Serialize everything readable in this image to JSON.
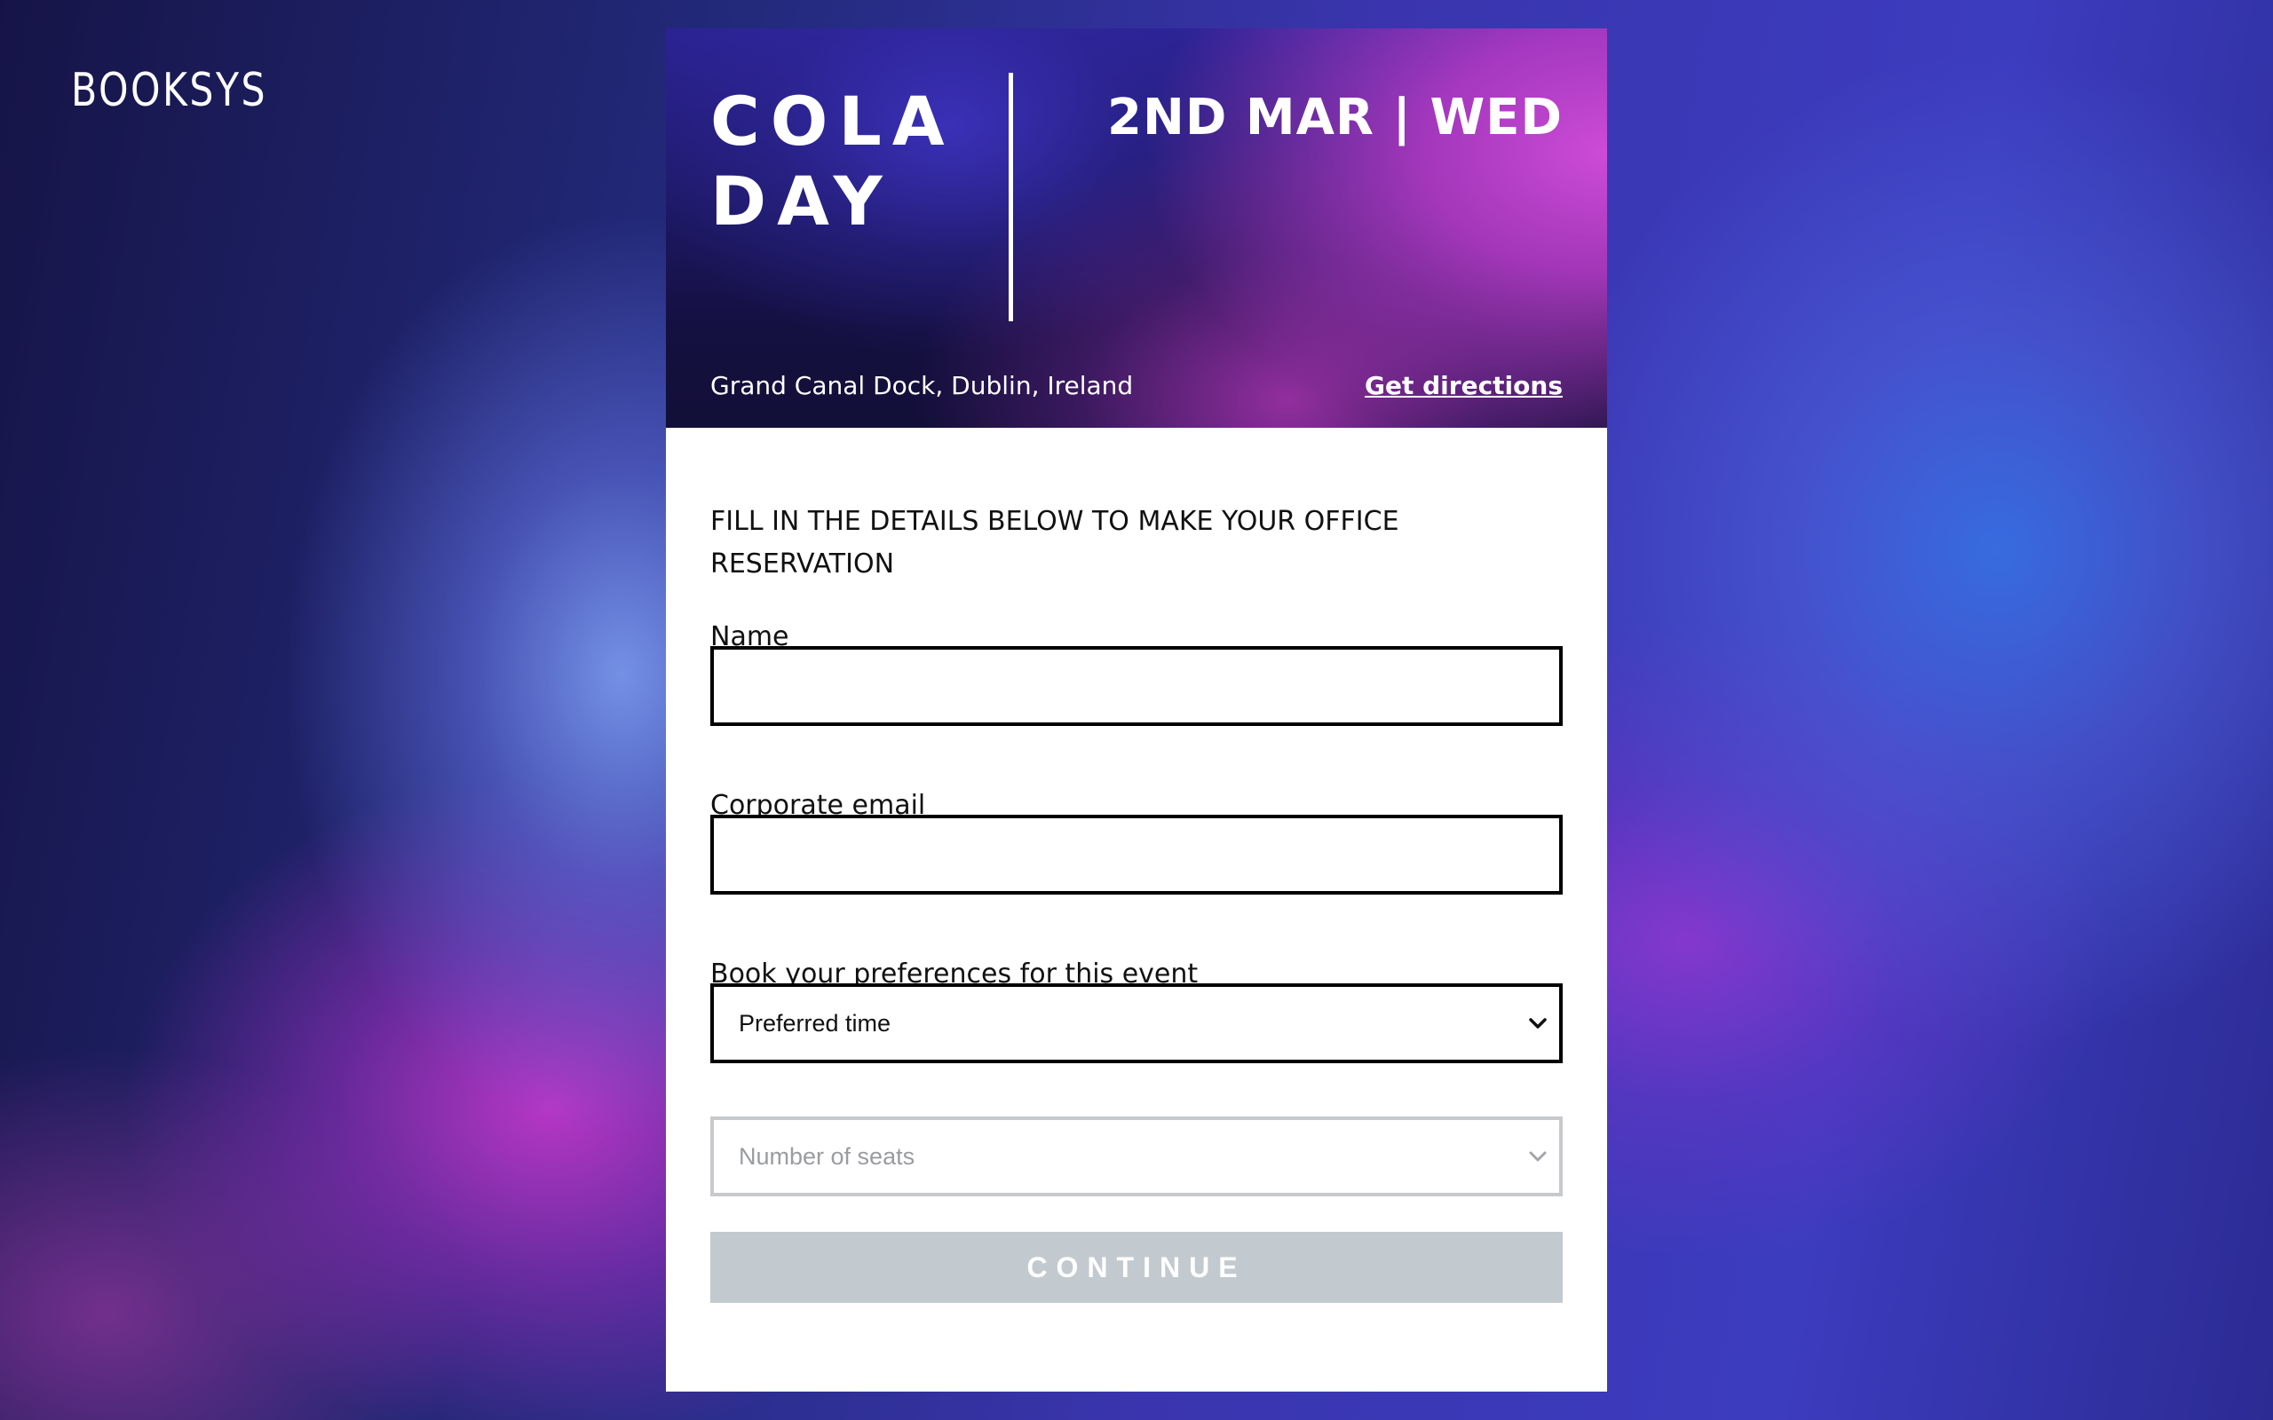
{
  "brand": {
    "logo_text": "BOOKSYS"
  },
  "event": {
    "title": "COLA DAY",
    "date": "2ND MAR | WED",
    "location": "Grand Canal Dock, Dublin, Ireland",
    "directions_label": "Get directions"
  },
  "form": {
    "intro": "FILL IN THE DETAILS BELOW TO MAKE YOUR OFFICE RESERVATION",
    "name_label": "Name",
    "name_value": "",
    "email_label": "Corporate email",
    "email_value": "",
    "preferences_label": "Book your preferences for this event",
    "preferred_time": "Preferred time",
    "number_of_seats": "Number of seats",
    "continue_label": "CONTINUE"
  },
  "colors": {
    "continue_disabled_bg": "#c3cacf",
    "input_border": "#000000",
    "disabled_border": "#c7c9cc"
  },
  "icons": {
    "preferred_time_dropdown": "chevron-down-icon",
    "seats_dropdown": "chevron-down-icon"
  }
}
